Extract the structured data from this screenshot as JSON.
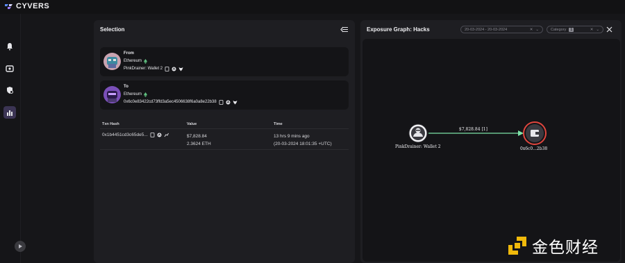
{
  "app": {
    "name": "CYVERS"
  },
  "selection": {
    "title": "Selection",
    "from": {
      "label": "From",
      "chain": "Ethereum",
      "name": "PinkDrainer: Wallet 2"
    },
    "to": {
      "label": "To",
      "chain": "Ethereum",
      "address": "0x6c0e83422cd73ffd3a5ec4506638f6a0a8e22b38"
    },
    "table": {
      "headers": [
        "Txn Hash",
        "Value",
        "Time"
      ],
      "rows": [
        {
          "hash": "0x1b4451cd3c65de5...",
          "value_usd": "$7,828.84",
          "value_eth": "2.3624  ETH",
          "time_rel": "13 hrs 9 mins ago",
          "time_abs": "(20-03-2024 18:01:35 +UTC)"
        }
      ]
    }
  },
  "graph": {
    "title": "Exposure Graph: Hacks",
    "date_filter": "20-03-2024 - 20-03-2024",
    "category_label": "Category",
    "category_count": "1",
    "source_label": "PinkDrainer: Wallet 2",
    "target_label": "0x6c0...2b38",
    "edge_label": "$7,828.84 [1]",
    "edge_color": "#7de3a8",
    "target_ring_color": "#e0463e"
  },
  "watermark": {
    "text": "金色财经"
  },
  "colors": {
    "accent": "#3b3454",
    "eth": "#5fbf7f"
  }
}
